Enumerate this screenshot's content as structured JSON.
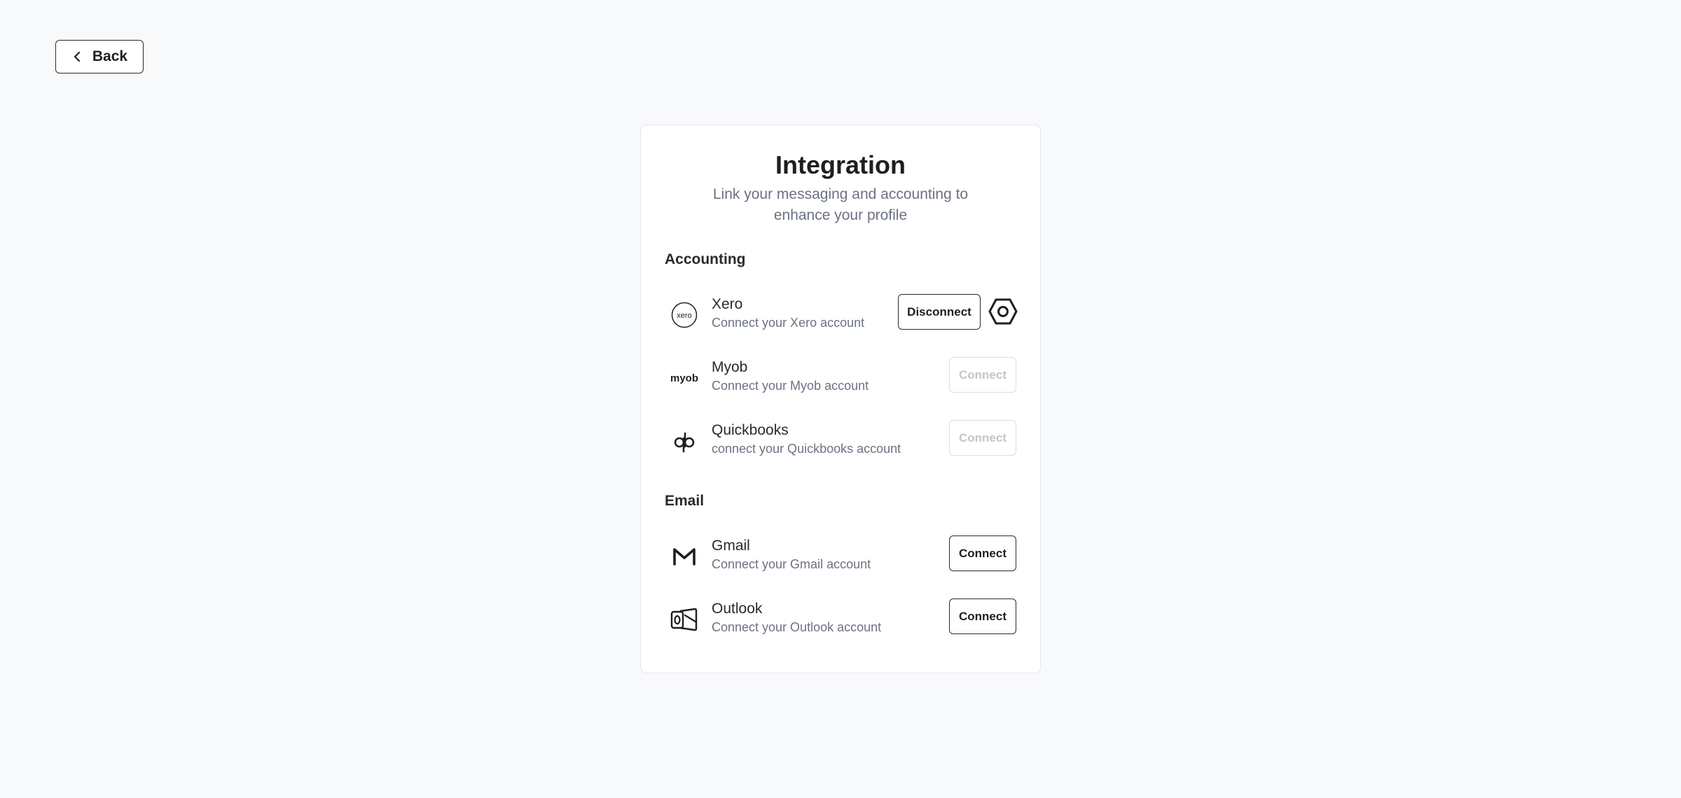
{
  "back": {
    "label": "Back"
  },
  "card": {
    "title": "Integration",
    "subtitle": "Link your messaging and accounting to enhance your profile"
  },
  "accounting": {
    "heading": "Accounting",
    "items": [
      {
        "name": "Xero",
        "desc": "Connect your Xero account",
        "action": "Disconnect",
        "logo_text": "xero",
        "icon": "xero-logo-icon"
      },
      {
        "name": "Myob",
        "desc": "Connect your Myob account",
        "action": "Connect",
        "logo_text": "myob",
        "icon": "myob-logo-icon",
        "disabled": true
      },
      {
        "name": "Quickbooks",
        "desc": "connect your Quickbooks account",
        "action": "Connect",
        "icon": "quickbooks-logo-icon",
        "disabled": true
      }
    ]
  },
  "email": {
    "heading": "Email",
    "items": [
      {
        "name": "Gmail",
        "desc": "Connect your Gmail account",
        "action": "Connect",
        "icon": "gmail-logo-icon"
      },
      {
        "name": "Outlook",
        "desc": "Connect your Outlook account",
        "action": "Connect",
        "icon": "outlook-logo-icon"
      }
    ]
  },
  "colors": {
    "background": "#f8f9fb",
    "text": "#1f1f23",
    "muted": "#6b7280",
    "border": "#2b2b2f",
    "disabled": "#c4c5ca"
  }
}
